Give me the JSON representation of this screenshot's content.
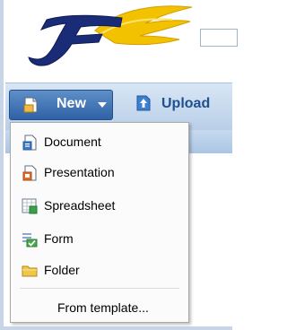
{
  "toolbar": {
    "new_label": "New",
    "upload_label": "Upload"
  },
  "menu": {
    "items": [
      {
        "label": "Document",
        "icon": "document-icon"
      },
      {
        "label": "Presentation",
        "icon": "presentation-icon"
      },
      {
        "label": "Spreadsheet",
        "icon": "spreadsheet-icon"
      },
      {
        "label": "Form",
        "icon": "form-icon"
      },
      {
        "label": "Folder",
        "icon": "folder-icon"
      },
      {
        "label": "From template...",
        "icon": ""
      }
    ]
  },
  "colors": {
    "toolbar_blue": "#2f62a6",
    "menu_bg": "#fbfbfb"
  }
}
